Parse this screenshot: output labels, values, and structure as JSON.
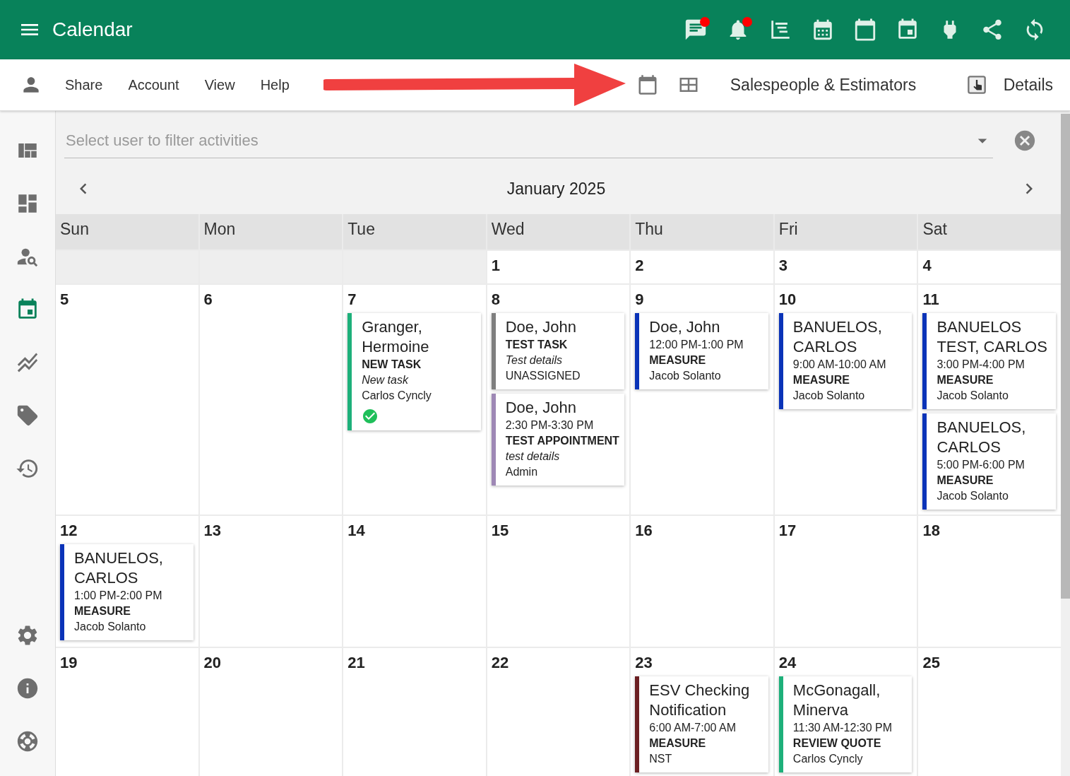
{
  "app_bar": {
    "title": "Calendar",
    "actions": [
      {
        "badge": true
      },
      {
        "badge": true
      },
      {
        "badge": false
      },
      {
        "badge": false
      },
      {
        "badge": false
      },
      {
        "badge": false
      },
      {
        "badge": false
      },
      {
        "badge": false
      },
      {
        "badge": false
      }
    ]
  },
  "toolbar": {
    "menu": [
      "Share",
      "Account",
      "View",
      "Help"
    ],
    "group": "Salespeople & Estimators",
    "details": "Details"
  },
  "sidebar": {
    "items": [
      {
        "selected": false
      },
      {
        "selected": false
      },
      {
        "selected": false
      },
      {
        "selected": true
      },
      {
        "selected": false
      },
      {
        "selected": false
      },
      {
        "selected": false
      }
    ],
    "bottom_items": [
      {
        "selected": false
      },
      {
        "selected": false
      },
      {
        "selected": false
      }
    ]
  },
  "filter": {
    "placeholder": "Select user to filter activities"
  },
  "calendar": {
    "month": "January 2025",
    "weekdays": [
      "Sun",
      "Mon",
      "Tue",
      "Wed",
      "Thu",
      "Fri",
      "Sat"
    ],
    "weeks": [
      [
        {
          "blank": true
        },
        {
          "blank": true
        },
        {
          "blank": true
        },
        {
          "day": "1"
        },
        {
          "day": "2"
        },
        {
          "day": "3"
        },
        {
          "day": "4"
        }
      ],
      [
        {
          "day": "5"
        },
        {
          "day": "6"
        },
        {
          "day": "7",
          "events": [
            {
              "title": "Granger, Hermoine",
              "color": "#1db07a",
              "done": true,
              "lines": [
                {
                  "kind": "type",
                  "text": "NEW TASK"
                },
                {
                  "kind": "details",
                  "text": "New task"
                },
                {
                  "kind": "person",
                  "text": "Carlos Cyncly"
                }
              ]
            }
          ]
        },
        {
          "day": "8",
          "events": [
            {
              "title": "Doe, John",
              "color": "#7f7f7f",
              "done": false,
              "lines": [
                {
                  "kind": "type",
                  "text": "TEST TASK"
                },
                {
                  "kind": "details",
                  "text": "Test details"
                },
                {
                  "kind": "person",
                  "text": "UNASSIGNED"
                }
              ]
            },
            {
              "title": "Doe, John",
              "color": "#9e88b5",
              "done": false,
              "lines": [
                {
                  "kind": "time",
                  "text": "2:30 PM-3:30 PM"
                },
                {
                  "kind": "type",
                  "text": "TEST APPOINTMENT"
                },
                {
                  "kind": "details",
                  "text": "test details"
                },
                {
                  "kind": "person",
                  "text": "Admin"
                }
              ]
            }
          ]
        },
        {
          "day": "9",
          "events": [
            {
              "title": "Doe, John",
              "color": "#0a33b8",
              "done": false,
              "lines": [
                {
                  "kind": "time",
                  "text": "12:00 PM-1:00 PM"
                },
                {
                  "kind": "type",
                  "text": "MEASURE"
                },
                {
                  "kind": "person",
                  "text": "Jacob Solanto"
                }
              ]
            }
          ]
        },
        {
          "day": "10",
          "events": [
            {
              "title": "BANUELOS, CARLOS",
              "color": "#0a33b8",
              "done": false,
              "lines": [
                {
                  "kind": "time",
                  "text": "9:00 AM-10:00 AM"
                },
                {
                  "kind": "type",
                  "text": "MEASURE"
                },
                {
                  "kind": "person",
                  "text": "Jacob Solanto"
                }
              ]
            }
          ]
        },
        {
          "day": "11",
          "events": [
            {
              "title": "BANUELOS TEST, CARLOS",
              "color": "#0a33b8",
              "done": false,
              "lines": [
                {
                  "kind": "time",
                  "text": "3:00 PM-4:00 PM"
                },
                {
                  "kind": "type",
                  "text": "MEASURE"
                },
                {
                  "kind": "person",
                  "text": "Jacob Solanto"
                }
              ]
            },
            {
              "title": "BANUELOS, CARLOS",
              "color": "#0a33b8",
              "done": false,
              "lines": [
                {
                  "kind": "time",
                  "text": "5:00 PM-6:00 PM"
                },
                {
                  "kind": "type",
                  "text": "MEASURE"
                },
                {
                  "kind": "person",
                  "text": "Jacob Solanto"
                }
              ]
            }
          ]
        }
      ],
      [
        {
          "day": "12",
          "events": [
            {
              "title": "BANUELOS, CARLOS",
              "color": "#0a33b8",
              "done": false,
              "lines": [
                {
                  "kind": "time",
                  "text": "1:00 PM-2:00 PM"
                },
                {
                  "kind": "type",
                  "text": "MEASURE"
                },
                {
                  "kind": "person",
                  "text": "Jacob Solanto"
                }
              ]
            }
          ]
        },
        {
          "day": "13"
        },
        {
          "day": "14"
        },
        {
          "day": "15"
        },
        {
          "day": "16"
        },
        {
          "day": "17"
        },
        {
          "day": "18"
        }
      ],
      [
        {
          "day": "19"
        },
        {
          "day": "20"
        },
        {
          "day": "21"
        },
        {
          "day": "22"
        },
        {
          "day": "23",
          "events": [
            {
              "title": "ESV Checking Notification",
              "color": "#6b1f22",
              "done": false,
              "lines": [
                {
                  "kind": "time",
                  "text": "6:00 AM-7:00 AM"
                },
                {
                  "kind": "type",
                  "text": "MEASURE"
                },
                {
                  "kind": "person",
                  "text": "NST"
                }
              ]
            }
          ]
        },
        {
          "day": "24",
          "events": [
            {
              "title": "McGonagall, Minerva",
              "color": "#1db07a",
              "done": false,
              "lines": [
                {
                  "kind": "time",
                  "text": "11:30 AM-12:30 PM"
                },
                {
                  "kind": "type",
                  "text": "REVIEW QUOTE"
                },
                {
                  "kind": "person",
                  "text": "Carlos Cyncly"
                }
              ]
            }
          ]
        },
        {
          "day": "25"
        }
      ]
    ]
  }
}
